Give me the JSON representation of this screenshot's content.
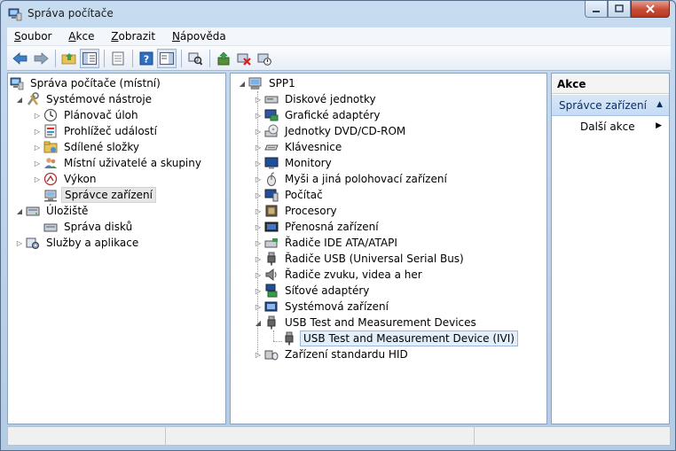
{
  "window": {
    "title": "Správa počítače",
    "controls": [
      "minimize",
      "maximize",
      "close"
    ]
  },
  "menu": [
    {
      "label": "Soubor",
      "accel": "S",
      "rest": "oubor"
    },
    {
      "label": "Akce",
      "accel": "A",
      "rest": "kce"
    },
    {
      "label": "Zobrazit",
      "accel": "Z",
      "rest": "obrazit"
    },
    {
      "label": "Nápověda",
      "accel": "N",
      "rest": "ápověda"
    }
  ],
  "toolbar": {
    "buttons": [
      "back-icon",
      "forward-icon",
      "up-folder-icon",
      "show-hide-tree-icon",
      "export-list-icon",
      "help-icon",
      "show-hide-action-pane-icon",
      "scan-hardware-icon",
      "update-driver-icon",
      "uninstall-icon",
      "disable-icon"
    ]
  },
  "left_tree": {
    "root": "Správa počítače (místní)",
    "items": [
      {
        "label": "Systémové nástroje",
        "level": 1,
        "expanded": true
      },
      {
        "label": "Plánovač úloh",
        "level": 2
      },
      {
        "label": "Prohlížeč událostí",
        "level": 2
      },
      {
        "label": "Sdílené složky",
        "level": 2
      },
      {
        "label": "Místní uživatelé a skupiny",
        "level": 2
      },
      {
        "label": "Výkon",
        "level": 2
      },
      {
        "label": "Správce zařízení",
        "level": 2,
        "selected": true
      },
      {
        "label": "Úložiště",
        "level": 1,
        "expanded": true
      },
      {
        "label": "Správa disků",
        "level": 2
      },
      {
        "label": "Služby a aplikace",
        "level": 1
      }
    ]
  },
  "device_tree": {
    "root": "SPP1",
    "categories": [
      "Diskové jednotky",
      "Grafické adaptéry",
      "Jednotky DVD/CD-ROM",
      "Klávesnice",
      "Monitory",
      "Myši a jiná polohovací zařízení",
      "Počítač",
      "Procesory",
      "Přenosná zařízení",
      "Řadiče IDE ATA/ATAPI",
      "Řadiče USB (Universal Serial Bus)",
      "Řadiče zvuku, videa a her",
      "Síťové adaptéry",
      "Systémová zařízení",
      "USB Test and Measurement Devices",
      "Zařízení standardu HID"
    ],
    "expanded_child": "USB Test and Measurement Device (IVI)"
  },
  "actions": {
    "header": "Akce",
    "section": "Správce zařízení",
    "item": "Další akce"
  }
}
